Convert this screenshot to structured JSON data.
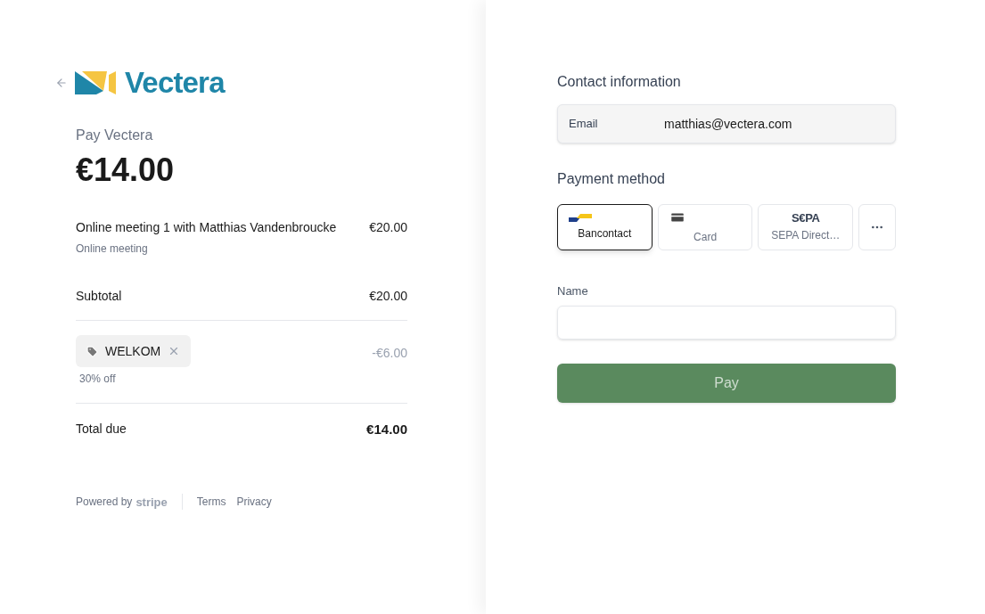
{
  "brand": {
    "name": "Vectera"
  },
  "summary": {
    "title": "Pay Vectera",
    "amount": "€14.00"
  },
  "line_items": [
    {
      "name": "Online meeting 1 with Matthias Vandenbroucke",
      "description": "Online meeting",
      "price": "€20.00"
    }
  ],
  "subtotal": {
    "label": "Subtotal",
    "value": "€20.00"
  },
  "promo": {
    "code": "WELKOM",
    "note": "30% off",
    "value": "-€6.00"
  },
  "total": {
    "label": "Total due",
    "value": "€14.00"
  },
  "footer": {
    "powered_by": "Powered by",
    "logo": "stripe",
    "links": [
      "Terms",
      "Privacy"
    ]
  },
  "contact": {
    "heading": "Contact information",
    "email_label": "Email",
    "email": "matthias@vectera.com"
  },
  "payment": {
    "heading": "Payment method",
    "methods": [
      {
        "kind": "bancontact",
        "label": "Bancontact",
        "selected": true
      },
      {
        "kind": "card",
        "label": "Card",
        "selected": false
      },
      {
        "kind": "sepa",
        "logo": "S€PA",
        "label": "SEPA Direct…",
        "selected": false
      },
      {
        "kind": "more",
        "selected": false
      }
    ]
  },
  "name_field": {
    "label": "Name"
  },
  "pay_button": {
    "label": "Pay"
  }
}
